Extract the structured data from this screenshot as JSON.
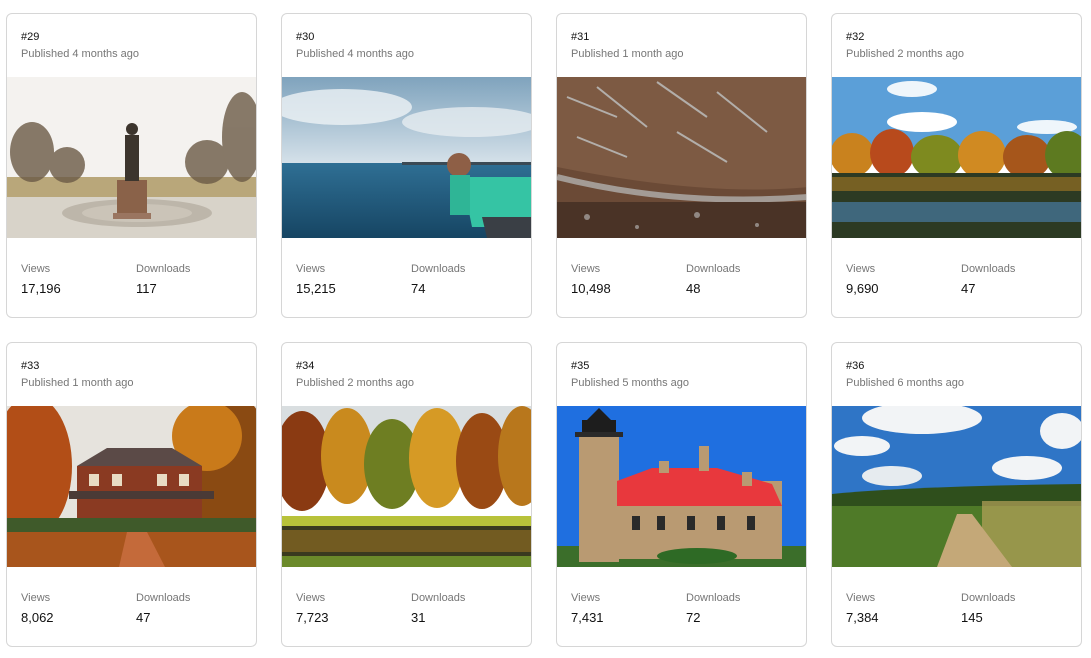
{
  "labels": {
    "views": "Views",
    "downloads": "Downloads"
  },
  "cards": [
    {
      "number": "#29",
      "published": "Published 4 months ago",
      "image": "statue-in-park",
      "views": "17,196",
      "downloads": "117"
    },
    {
      "number": "#30",
      "published": "Published 4 months ago",
      "image": "boy-looking-at-lake",
      "views": "15,215",
      "downloads": "74"
    },
    {
      "number": "#31",
      "published": "Published 1 month ago",
      "image": "frosted-leaf-closeup",
      "views": "10,498",
      "downloads": "48"
    },
    {
      "number": "#32",
      "published": "Published 2 months ago",
      "image": "autumn-trees-reflection",
      "views": "9,690",
      "downloads": "47"
    },
    {
      "number": "#33",
      "published": "Published 1 month ago",
      "image": "brick-house-autumn",
      "views": "8,062",
      "downloads": "47"
    },
    {
      "number": "#34",
      "published": "Published 2 months ago",
      "image": "autumn-forest-pond",
      "views": "7,723",
      "downloads": "31"
    },
    {
      "number": "#35",
      "published": "Published 5 months ago",
      "image": "lighthouse-red-roof",
      "views": "7,431",
      "downloads": "72"
    },
    {
      "number": "#36",
      "published": "Published 6 months ago",
      "image": "dirt-path-meadow",
      "views": "7,384",
      "downloads": "145"
    }
  ]
}
